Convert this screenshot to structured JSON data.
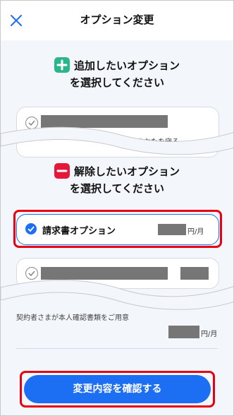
{
  "header": {
    "title": "オプション変更"
  },
  "add_section": {
    "line1": "追加したいオプション",
    "line2": "を選択してください",
    "icon": "plus-icon",
    "color": "#2bb58a"
  },
  "add_card": {
    "partial_text": "ブルからあなたを守る"
  },
  "remove_section": {
    "line1": "解除したいオプション",
    "line2": "を選択してください",
    "icon": "minus-icon",
    "color": "#e5183a"
  },
  "remove_options": [
    {
      "label": "請求書オプション",
      "price_unit": "円/月",
      "checked": true
    },
    {
      "label": "",
      "price_unit": "",
      "checked": false
    }
  ],
  "lower_block": {
    "text": "契約者さまが本人確認書類をご用意",
    "price_unit": "円/月"
  },
  "cta": {
    "label": "変更内容を確認する"
  },
  "colors": {
    "accent": "#1c6ef2",
    "highlight": "#e60012"
  }
}
